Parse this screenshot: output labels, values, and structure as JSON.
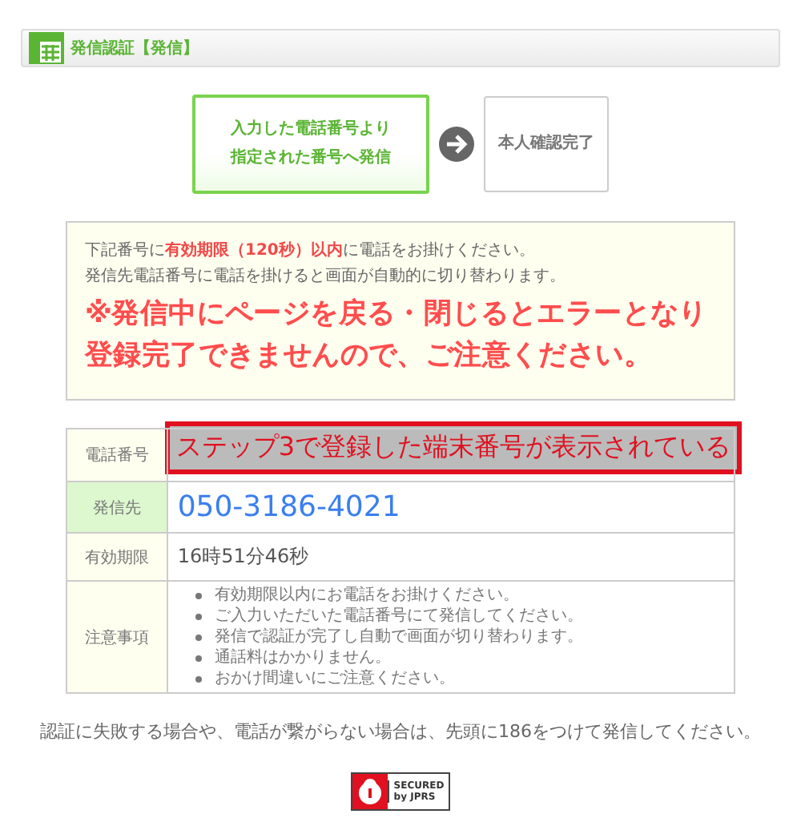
{
  "header": {
    "title": "発信認証【発信】"
  },
  "steps": [
    {
      "lines": [
        "入力した電話番号より",
        "指定された番号へ発信"
      ],
      "selected": true
    },
    {
      "lines": [
        "本人確認完了"
      ],
      "selected": false
    }
  ],
  "notice": {
    "line_1": "下記番号に**有効期限（120秒）以内**に電話をお掛けください。",
    "line_2": "発信先電話番号に電話を掛けると画面が自動的に切り替わります。",
    "warning": "※発信中にページを戻る・閉じるとエラーとなり登録完了できませんので、ご注意ください。"
  },
  "table": {
    "rows": [
      {
        "kind": "annotated",
        "label": "電話番号",
        "annotation": "ステップ3で登録した端末番号が表示されている"
      },
      {
        "kind": "phone",
        "label": "発信先",
        "value": "050-3186-4021"
      },
      {
        "kind": "text",
        "label": "有効期限",
        "value": "16時51分46秒"
      },
      {
        "kind": "list",
        "label": "注意事項",
        "items": [
          "有効期限以内にお電話をお掛けください。",
          "ご入力いただいた電話番号にて発信してください。",
          "発信で認証が完了し自動で画面が切り替わります。",
          "通話料はかかりません。",
          "おかけ間違いにご注意ください。"
        ]
      }
    ]
  },
  "footer_note": "認証に失敗する場合や、電話が繋がらない場合は、先頭に186をつけて発信してください。",
  "badge": {
    "line_1": "SECURED",
    "line_2": "by JPRS"
  }
}
